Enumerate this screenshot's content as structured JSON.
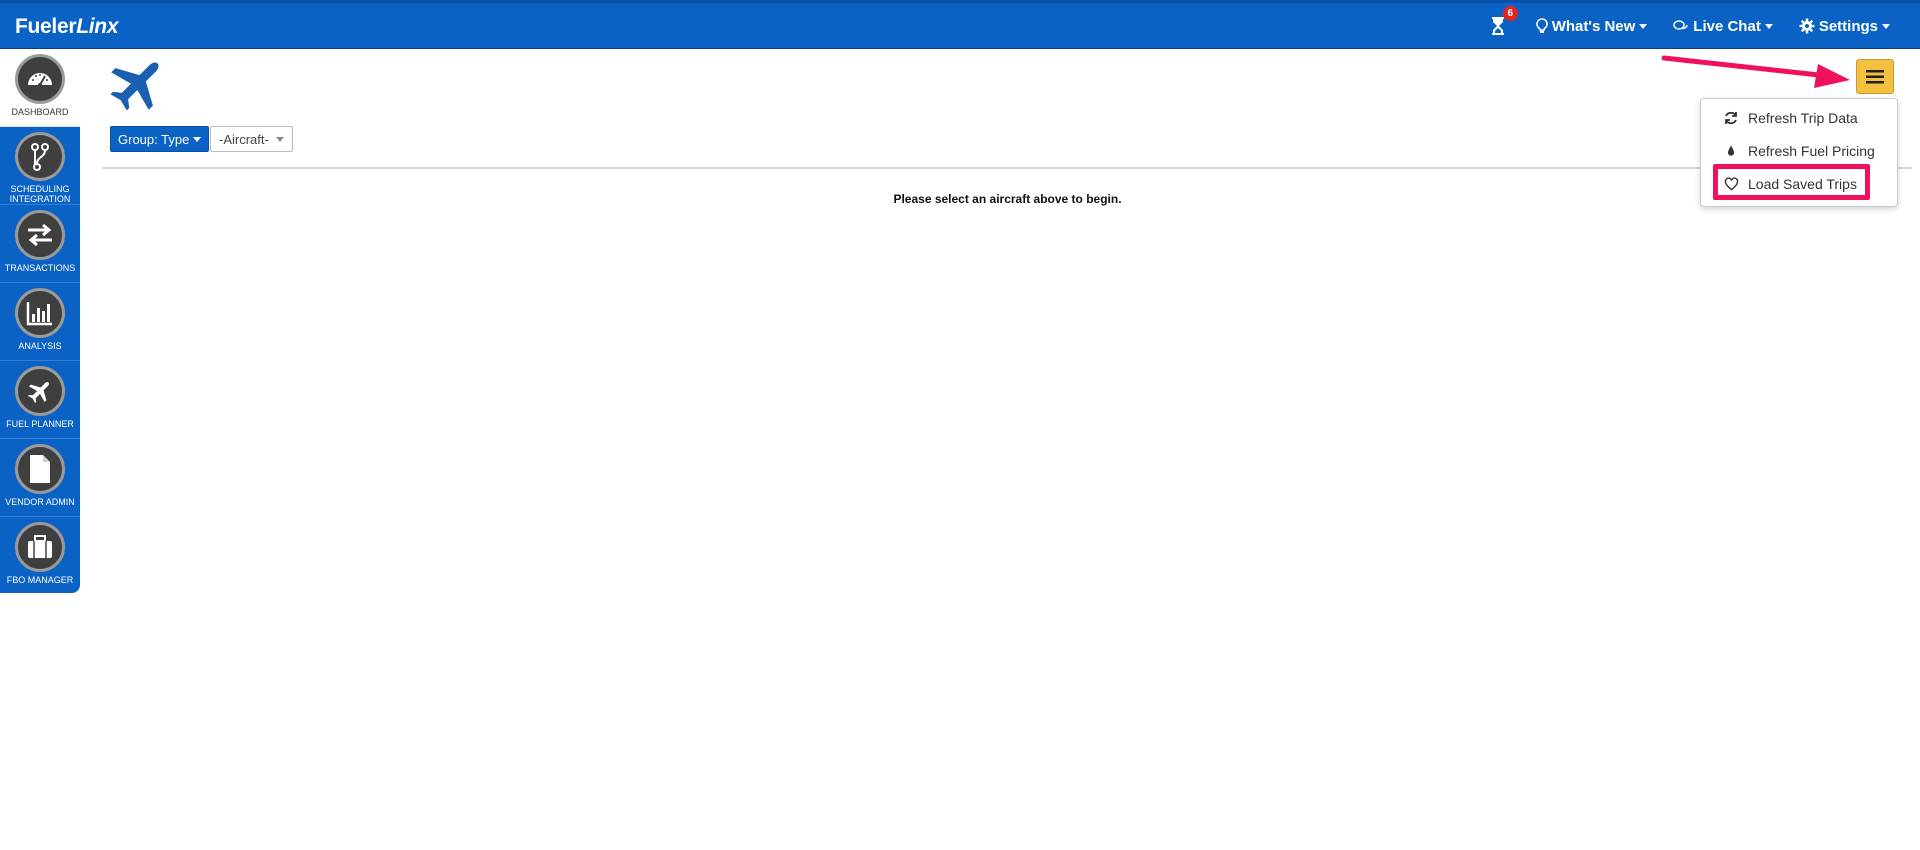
{
  "brand": {
    "name_plain": "Fueler",
    "name_italic": "Linx"
  },
  "topnav": {
    "notification_count": "6",
    "whats_new": "What's New",
    "live_chat": "Live Chat",
    "settings": "Settings"
  },
  "sidebar": {
    "items": [
      {
        "label": "DASHBOARD"
      },
      {
        "label": "SCHEDULING INTEGRATION"
      },
      {
        "label": "TRANSACTIONS"
      },
      {
        "label": "ANALYSIS"
      },
      {
        "label": "FUEL PLANNER"
      },
      {
        "label": "VENDOR ADMIN"
      },
      {
        "label": "FBO MANAGER"
      }
    ]
  },
  "toolbar": {
    "group_label": "Group: Type",
    "aircraft_value": "-Aircraft-"
  },
  "main": {
    "message": "Please select an aircraft above to begin."
  },
  "menu": {
    "items": [
      {
        "label": "Refresh Trip Data",
        "icon": "refresh-icon"
      },
      {
        "label": "Refresh Fuel Pricing",
        "icon": "droplet-icon"
      },
      {
        "label": "Load Saved Trips",
        "icon": "heart-icon"
      }
    ]
  },
  "colors": {
    "primary": "#0a63c4",
    "menu_button": "#f3c03f",
    "annotation": "#f0115e",
    "badge": "#e52421"
  }
}
